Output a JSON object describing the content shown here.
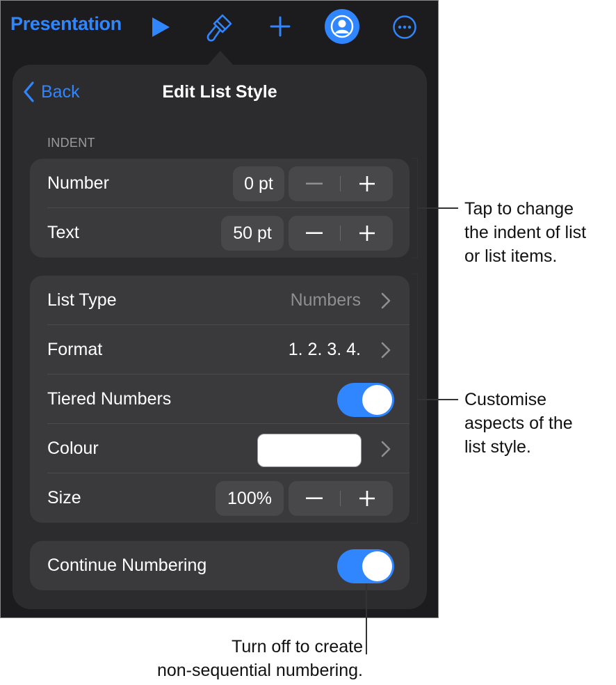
{
  "toolbar": {
    "title": "Presentation",
    "icons": [
      "play-icon",
      "paintbrush-icon",
      "plus-icon",
      "collaborate-icon",
      "more-icon"
    ],
    "accent": "#2f86ff"
  },
  "popover": {
    "back_label": "Back",
    "title": "Edit List Style"
  },
  "indent": {
    "section_label": "INDENT",
    "rows": [
      {
        "label": "Number",
        "value": "0 pt"
      },
      {
        "label": "Text",
        "value": "50 pt"
      }
    ]
  },
  "list_settings": {
    "list_type": {
      "label": "List Type",
      "value": "Numbers"
    },
    "format": {
      "label": "Format",
      "value": "1. 2. 3. 4."
    },
    "tiered": {
      "label": "Tiered Numbers",
      "on": true
    },
    "colour": {
      "label": "Colour",
      "swatch": "#ffffff"
    },
    "size": {
      "label": "Size",
      "value": "100%"
    }
  },
  "continue": {
    "label": "Continue Numbering",
    "on": true
  },
  "callouts": {
    "indent": [
      "Tap to change",
      "the indent of list",
      "or list items."
    ],
    "customise": [
      "Customise",
      "aspects of the",
      "list style."
    ],
    "continue": [
      "Turn off to create",
      "non-sequential numbering."
    ]
  }
}
